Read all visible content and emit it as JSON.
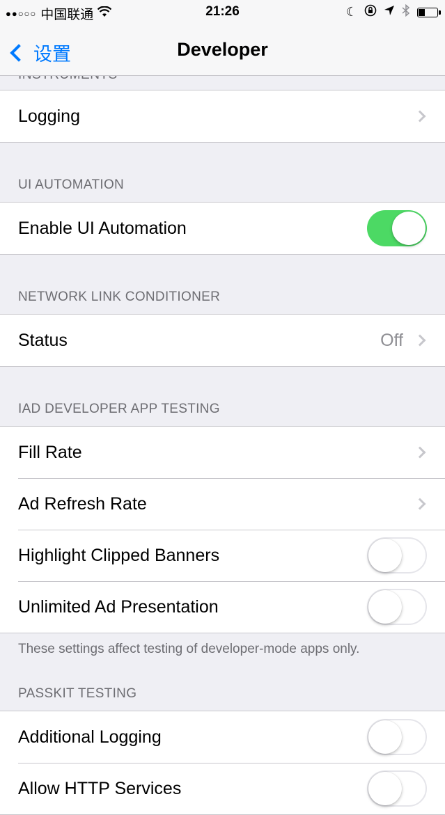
{
  "status_bar": {
    "signal": "●●○○○",
    "carrier": "中国联通",
    "time": "21:26"
  },
  "nav": {
    "back_label": "设置",
    "title": "Developer"
  },
  "sections": {
    "instruments": {
      "header": "INSTRUMENTS",
      "logging": "Logging"
    },
    "ui_automation": {
      "header": "UI AUTOMATION",
      "enable": "Enable UI Automation",
      "enable_on": true
    },
    "network": {
      "header": "NETWORK LINK CONDITIONER",
      "status": "Status",
      "status_value": "Off"
    },
    "iad": {
      "header": "IAD DEVELOPER APP TESTING",
      "fill_rate": "Fill Rate",
      "ad_refresh_rate": "Ad Refresh Rate",
      "highlight_clipped": "Highlight Clipped Banners",
      "unlimited_ad": "Unlimited Ad Presentation",
      "footer": "These settings affect testing of developer-mode apps only."
    },
    "passkit": {
      "header": "PASSKIT TESTING",
      "additional_logging": "Additional Logging",
      "allow_http": "Allow HTTP Services"
    }
  },
  "colors": {
    "accent": "#007aff",
    "switch_on": "#4cd964"
  }
}
